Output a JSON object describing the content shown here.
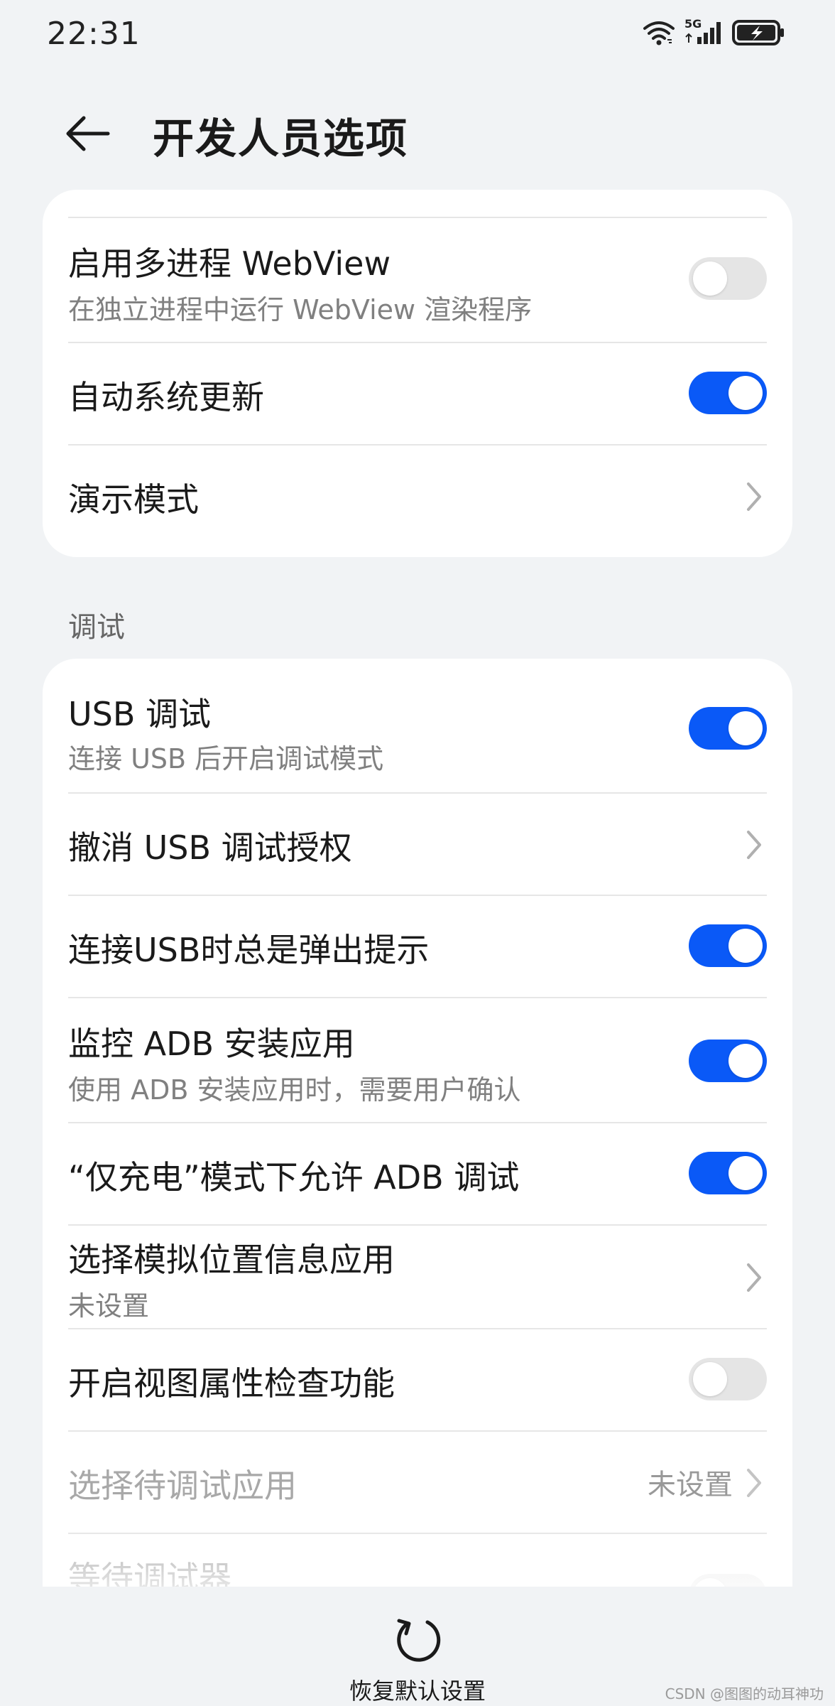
{
  "status_bar": {
    "time": "22:31",
    "network": "5G"
  },
  "header": {
    "title": "开发人员选项"
  },
  "top_group": {
    "items": [
      {
        "title": "启用多进程 WebView",
        "subtitle": "在独立进程中运行 WebView 渲染程序",
        "toggle": false
      },
      {
        "title": "自动系统更新",
        "toggle": true
      },
      {
        "title": "演示模式"
      }
    ]
  },
  "debug_section": {
    "label": "调试",
    "items": [
      {
        "title": "USB 调试",
        "subtitle": "连接 USB 后开启调试模式",
        "toggle": true
      },
      {
        "title": "撤消 USB 调试授权"
      },
      {
        "title": "连接USB时总是弹出提示",
        "toggle": true
      },
      {
        "title": "监控 ADB 安装应用",
        "subtitle": "使用 ADB 安装应用时，需要用户确认",
        "toggle": true
      },
      {
        "title": "“仅充电”模式下允许 ADB 调试",
        "toggle": true
      },
      {
        "title": "选择模拟位置信息应用",
        "subtitle": "未设置"
      },
      {
        "title": "开启视图属性检查功能",
        "toggle": false
      },
      {
        "title": "选择待调试应用",
        "value": "未设置"
      },
      {
        "title": "等待调试器",
        "toggle": false
      }
    ]
  },
  "bottom": {
    "reset_label": "恢复默认设置"
  },
  "watermark": "CSDN @图图的动耳神功",
  "colors": {
    "accent": "#0a59f7",
    "background": "#f1f3f5",
    "card": "#ffffff"
  }
}
